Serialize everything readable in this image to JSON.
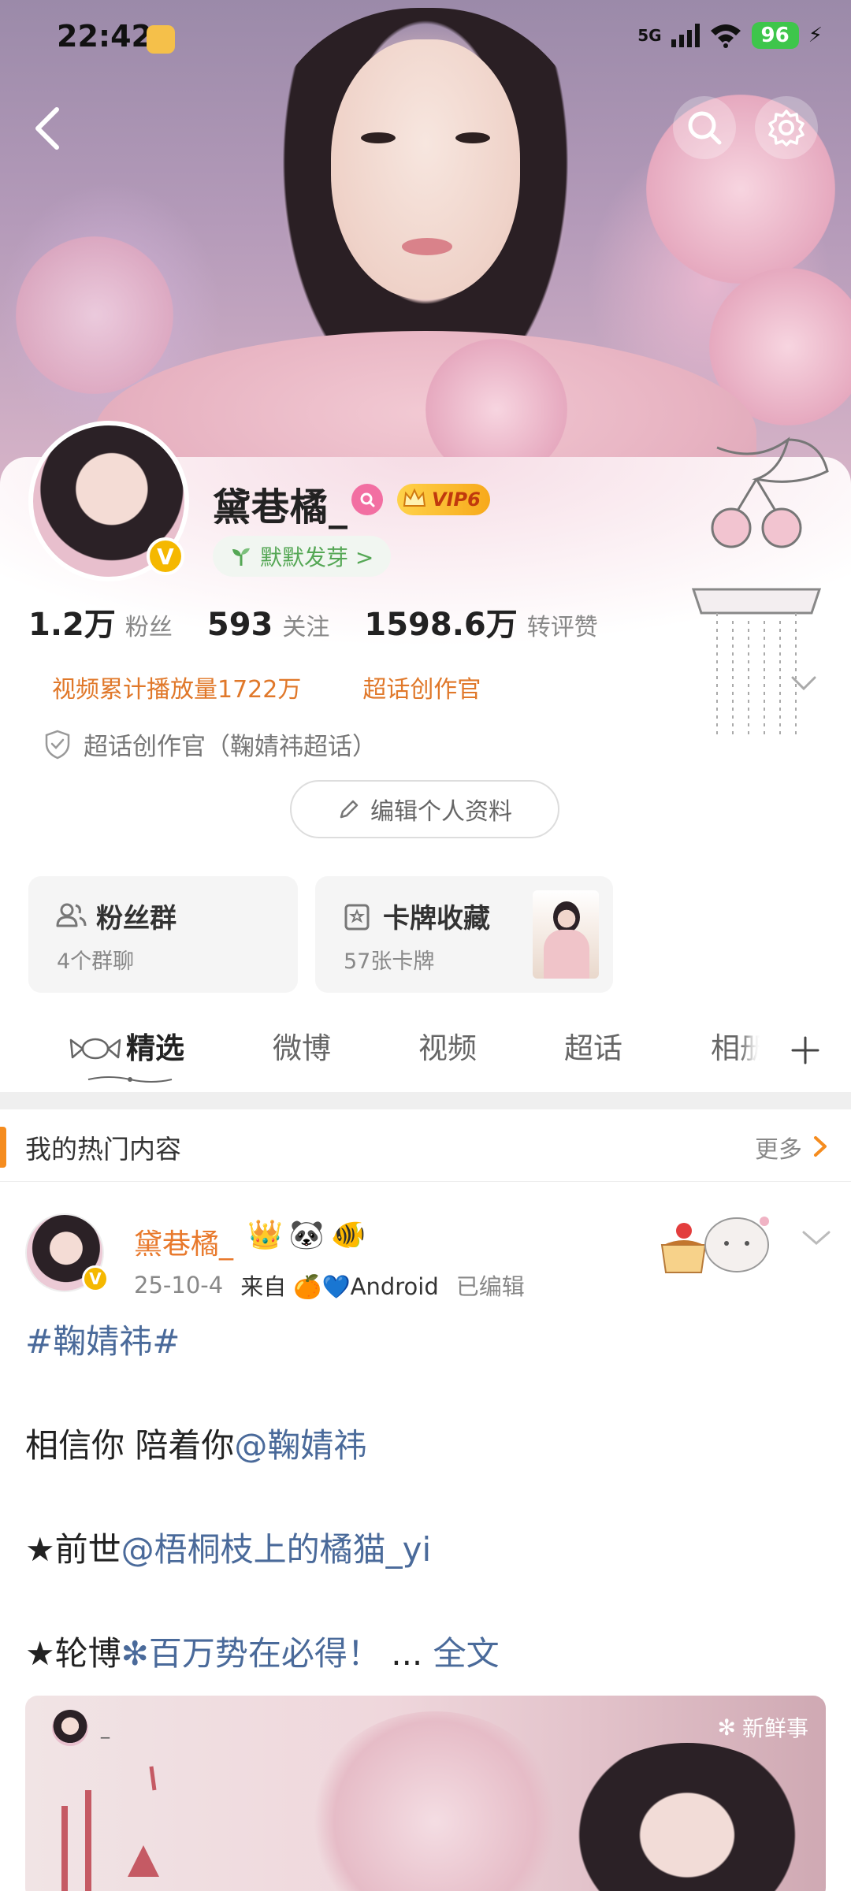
{
  "status": {
    "time": "22:42",
    "network": "5G",
    "battery": "96"
  },
  "profile": {
    "name": "黛巷橘_",
    "vip_label": "VIP6",
    "sprout_label": "默默发芽 >",
    "stats": [
      {
        "num": "1.2万",
        "label": "粉丝"
      },
      {
        "num": "593",
        "label": "关注"
      },
      {
        "num": "1598.6万",
        "label": "转评赞"
      }
    ],
    "tags": [
      "视频累计播放量1722万",
      "超话创作官"
    ],
    "certification": "超话创作官（鞠婧祎超话）",
    "edit_button": "编辑个人资料",
    "avatar_badge": "V"
  },
  "tiles": [
    {
      "title": "粉丝群",
      "sub": "4个群聊"
    },
    {
      "title": "卡牌收藏",
      "sub": "57张卡牌"
    }
  ],
  "tabs": [
    "精选",
    "微博",
    "视频",
    "超话",
    "相册"
  ],
  "hot": {
    "title": "我的热门内容",
    "more": "更多"
  },
  "post": {
    "name": "黛巷橘_",
    "date": "25-10-4",
    "from": "来自",
    "device": "Android",
    "edited": "已编辑",
    "topic": "#鞠婧祎#",
    "line1_text": "相信你 陪着你",
    "line1_link": "@鞠婧祎",
    "line2_star": "★前世",
    "line2_link": "@梧桐枝上的橘猫_yi",
    "line3_star": "★轮博",
    "line3_link": "百万势在必得！",
    "ellipsis": "...",
    "full_text": "全文",
    "media_tag": "新鲜事",
    "media_caption": "_"
  },
  "colors": {
    "accent_orange": "#f58c1f",
    "link_blue": "#4a6a9a",
    "name_orange": "#e8792c",
    "sprout_green": "#55a755"
  },
  "icons": [
    "back-arrow-icon",
    "search-icon",
    "gear-icon",
    "verified-icon",
    "crown-icon",
    "sprout-icon",
    "shield-icon",
    "pencil-icon",
    "people-icon",
    "card-icon",
    "plus-icon",
    "chevron-right-icon",
    "chevron-down-icon"
  ]
}
